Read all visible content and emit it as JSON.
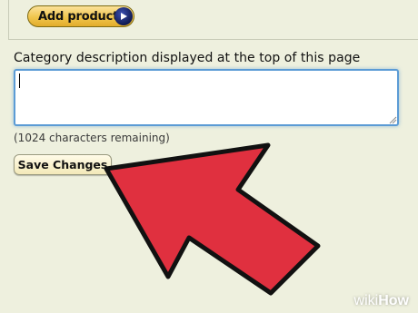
{
  "toolbar": {
    "add_products_label": "Add products"
  },
  "description": {
    "label": "Category description displayed at the top of this page",
    "value": "",
    "remaining_text": "(1024 characters remaining)"
  },
  "actions": {
    "save_label": "Save Changes"
  },
  "watermark": {
    "part1": "wiki",
    "part2": "How"
  },
  "colors": {
    "background": "#eef0de",
    "add_button": "#f0c54c",
    "pointer_arrow": "#e0303f",
    "input_focus": "#5b9bd5"
  }
}
